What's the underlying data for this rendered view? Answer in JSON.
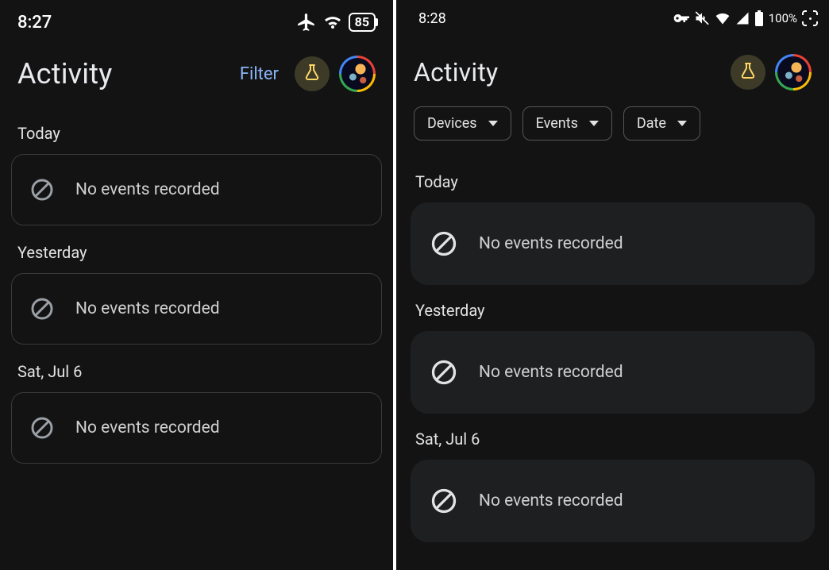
{
  "left": {
    "status": {
      "time": "8:27",
      "battery": "85"
    },
    "title": "Activity",
    "filter_label": "Filter",
    "sections": [
      {
        "label": "Today",
        "message": "No events recorded"
      },
      {
        "label": "Yesterday",
        "message": "No events recorded"
      },
      {
        "label": "Sat, Jul 6",
        "message": "No events recorded"
      }
    ]
  },
  "right": {
    "status": {
      "time": "8:28",
      "battery": "100%"
    },
    "title": "Activity",
    "chips": [
      "Devices",
      "Events",
      "Date"
    ],
    "sections": [
      {
        "label": "Today",
        "message": "No events recorded"
      },
      {
        "label": "Yesterday",
        "message": "No events recorded"
      },
      {
        "label": "Sat, Jul 6",
        "message": "No events recorded"
      }
    ]
  }
}
